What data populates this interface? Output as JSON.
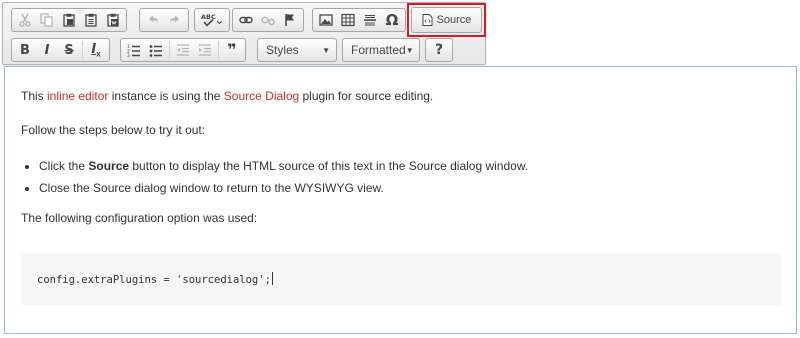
{
  "toolbar": {
    "row1": [
      {
        "name": "cut-button",
        "icon": "scissors-icon",
        "disabled": true
      },
      {
        "name": "copy-button",
        "icon": "copy-icon",
        "disabled": true
      },
      {
        "name": "paste-button",
        "icon": "paste-icon",
        "disabled": false
      },
      {
        "name": "paste-text-button",
        "icon": "paste-text-icon",
        "disabled": false
      },
      {
        "name": "paste-from-word-button",
        "icon": "paste-word-icon",
        "disabled": false
      },
      {
        "name": "undo-button",
        "icon": "undo-icon",
        "disabled": true
      },
      {
        "name": "redo-button",
        "icon": "redo-icon",
        "disabled": true
      },
      {
        "name": "spellcheck-button",
        "icon": "spellcheck-icon",
        "label": "ABC"
      },
      {
        "name": "link-button",
        "icon": "link-icon"
      },
      {
        "name": "unlink-button",
        "icon": "unlink-icon",
        "disabled": true
      },
      {
        "name": "anchor-button",
        "icon": "flag-icon"
      },
      {
        "name": "image-button",
        "icon": "image-icon"
      },
      {
        "name": "table-button",
        "icon": "table-icon"
      },
      {
        "name": "horizontal-rule-button",
        "icon": "horizontal-rule-icon"
      },
      {
        "name": "special-char-button",
        "icon": "omega-icon",
        "label": "Ω"
      }
    ],
    "source_button": {
      "label": "Source",
      "icon": "source-icon"
    },
    "row2": {
      "bold_label": "B",
      "italic_label": "I",
      "strike_label": "S",
      "remove_format_label": "I",
      "remove_format_sub": "x",
      "blockquote_label": "❞",
      "styles_combo": "Styles",
      "format_combo": "Formatted",
      "help_label": "?"
    }
  },
  "editor": {
    "intro": {
      "pre": "This ",
      "link1": "inline editor",
      "mid": " instance is using the ",
      "link2": "Source Dialog",
      "post": " plugin for source editing."
    },
    "steps_intro": "Follow the steps below to try it out:",
    "steps": [
      {
        "pre": "Click the ",
        "bold": "Source",
        "post": " button to display the HTML source of this text in the Source dialog window."
      },
      {
        "text": "Close the Source dialog window to return to the WYSIWYG view."
      }
    ],
    "config_intro": "The following configuration option was used:",
    "code": "config.extraPlugins = 'sourcedialog';"
  },
  "colors": {
    "link": "#c2342b",
    "highlight": "#e01818",
    "editor_border": "#9db8d8",
    "code_bg": "#f6f6f6"
  }
}
